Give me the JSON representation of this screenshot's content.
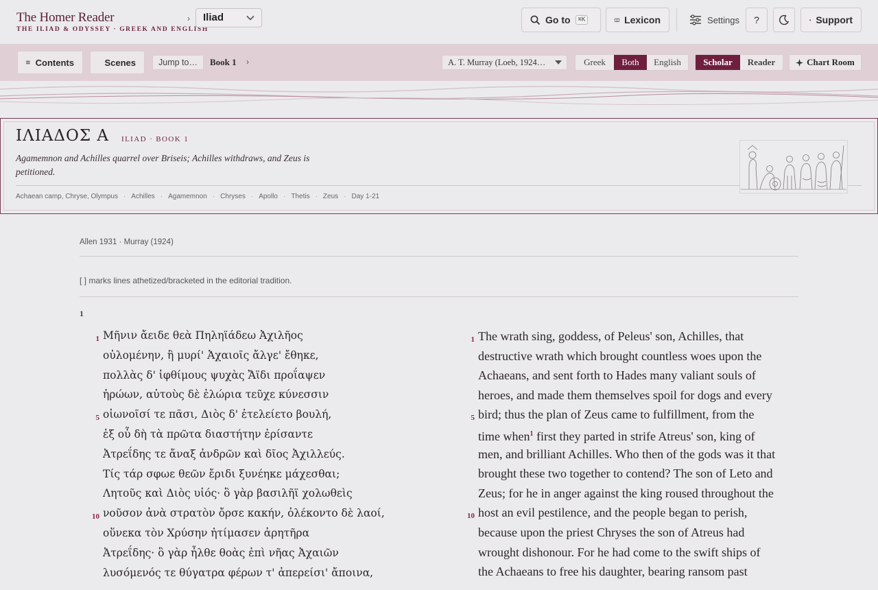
{
  "brand": {
    "title": "The Homer Reader",
    "subtitle": "THE ILIAD & ODYSSEY · GREEK AND ENGLISH"
  },
  "topbar": {
    "crumb_sep": "›",
    "work": "Iliad",
    "goto_label": "Go to",
    "goto_shortcut": "⌘K",
    "lexicon_label": "Lexicon",
    "settings_label": "Settings",
    "help_label": "?",
    "support_label": "Support"
  },
  "subbar": {
    "contents_label": "Contents",
    "scenes_label": "Scenes",
    "jump_label": "Jump to…",
    "book_label": "Book 1",
    "book_arrow": "›",
    "translation": "A. T. Murray (Loeb, 1924…",
    "language_modes": [
      "Greek",
      "Both",
      "English"
    ],
    "language_active": "Both",
    "view_modes": [
      "Scholar",
      "Reader"
    ],
    "view_active": "Scholar",
    "chart_room_label": "Chart Room"
  },
  "book": {
    "greek_title": "ΙΛΙΑΔΟΣ Α",
    "tag": "ILIAD · BOOK 1",
    "summary": "Agamemnon and Achilles quarrel over Briseis; Achilles withdraws, and Zeus is petitioned.",
    "tags": [
      "Achaean camp, Chryse, Olympus",
      "Achilles",
      "Agamemnon",
      "Chryses",
      "Apollo",
      "Thetis",
      "Zeus",
      "Day 1-21"
    ]
  },
  "text": {
    "edition": "Allen 1931 · Murray (1924)",
    "note": "[ ] marks lines athetized/bracketed in the editorial tradition.",
    "section": "1",
    "greek_lines": [
      {
        "n": "1",
        "t": "Μῆνιν ἄειδε θεὰ Πηληϊάδεω Ἀχιλῆος"
      },
      {
        "n": "",
        "t": "οὐλομένην, ἣ μυρί' Ἀχαιοῖς ἄλγε' ἔθηκε,"
      },
      {
        "n": "",
        "t": "πολλὰς δ' ἰφθίμους ψυχὰς Ἄϊδι προΐαψεν"
      },
      {
        "n": "",
        "t": "ἡρώων, αὐτοὺς δὲ ἑλώρια τεῦχε κύνεσσιν"
      },
      {
        "n": "5",
        "t": "οἰωνοῖσί τε πᾶσι, Διὸς δ' ἐτελείετο βουλή,"
      },
      {
        "n": "",
        "t": "ἐξ οὗ δὴ τὰ πρῶτα διαστήτην ἐρίσαντε"
      },
      {
        "n": "",
        "t": "Ἀτρεΐδης τε ἄναξ ἀνδρῶν καὶ δῖος Ἀχιλλεύς."
      },
      {
        "n": "",
        "t": "Τίς τάρ σφωε θεῶν ἔριδι ξυνέηκε μάχεσθαι;"
      },
      {
        "n": "",
        "t": "Λητοῦς καὶ Διὸς υἱός· ὃ γὰρ βασιλῆϊ χολωθεὶς"
      },
      {
        "n": "10",
        "t": "νοῦσον ἀνὰ στρατὸν ὄρσε κακήν, ὀλέκοντο δὲ λαοί,"
      },
      {
        "n": "",
        "t": "οὕνεκα τὸν Χρύσην ἠτίμασεν ἀρητῆρα"
      },
      {
        "n": "",
        "t": "Ἀτρεΐδης· ὃ γὰρ ἦλθε θοὰς ἐπὶ νῆας Ἀχαιῶν"
      },
      {
        "n": "",
        "t": "λυσόμενός τε θύγατρα φέρων τ' ἀπερείσι' ἄποινα,"
      }
    ],
    "english_lines": [
      {
        "n": "1",
        "t": "The wrath sing, goddess, of Peleus' son, Achilles, that"
      },
      {
        "n": "",
        "t": "destructive wrath which brought countless woes upon the"
      },
      {
        "n": "",
        "t": "Achaeans, and sent forth to Hades many valiant souls of"
      },
      {
        "n": "",
        "t": "heroes, and made them themselves spoil for dogs and every"
      },
      {
        "n": "5",
        "t": "bird; thus the plan of Zeus came to fulfillment, from the"
      },
      {
        "n": "",
        "t": "time when",
        "sup": "1",
        "t2": " first they parted in strife Atreus' son, king of"
      },
      {
        "n": "",
        "t": "men, and brilliant Achilles. Who then of the gods was it that"
      },
      {
        "n": "",
        "t": "brought these two together to contend? The son of Leto and"
      },
      {
        "n": "",
        "t": "Zeus; for he in anger against the king roused throughout the"
      },
      {
        "n": "10",
        "t": "host an evil pestilence, and the people began to perish,"
      },
      {
        "n": "",
        "t": "because upon the priest Chryses the son of Atreus had"
      },
      {
        "n": "",
        "t": "wrought dishonour. For he had come to the swift ships of"
      },
      {
        "n": "",
        "t": "the Achaeans to free his daughter, bearing ransom past"
      }
    ]
  },
  "colors": {
    "accent": "#6f1f3e",
    "subbar_bg": "#e1cfd6",
    "line_number": "#8a2548"
  },
  "icons": {
    "goto": "search-icon",
    "lexicon": "book-icon",
    "settings": "sliders-icon",
    "theme": "moon-icon",
    "support": "heart-icon",
    "contents": "list-icon",
    "scenes": "sparkle-icon",
    "chart_room": "star-icon"
  }
}
